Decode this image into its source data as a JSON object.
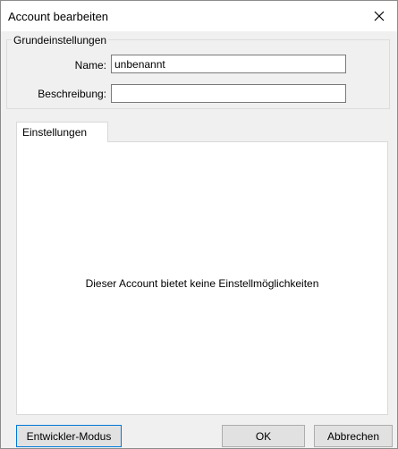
{
  "window": {
    "title": "Account bearbeiten",
    "close_glyph": "✕"
  },
  "basic_settings": {
    "legend": "Grundeinstellungen",
    "name_label": "Name:",
    "name_value": "unbenannt",
    "description_label": "Beschreibung:",
    "description_value": ""
  },
  "tabs": [
    {
      "label": "Einstellungen",
      "selected": true
    }
  ],
  "settings_panel": {
    "message": "Dieser Account bietet keine Einstellmöglichkeiten"
  },
  "buttons": {
    "developer_mode": "Entwickler-Modus",
    "ok": "OK",
    "cancel": "Abbrechen"
  },
  "icons": {
    "close": "close-icon"
  },
  "colors": {
    "focus_border": "#0078d7",
    "dialog_background": "#f0f0f0"
  }
}
